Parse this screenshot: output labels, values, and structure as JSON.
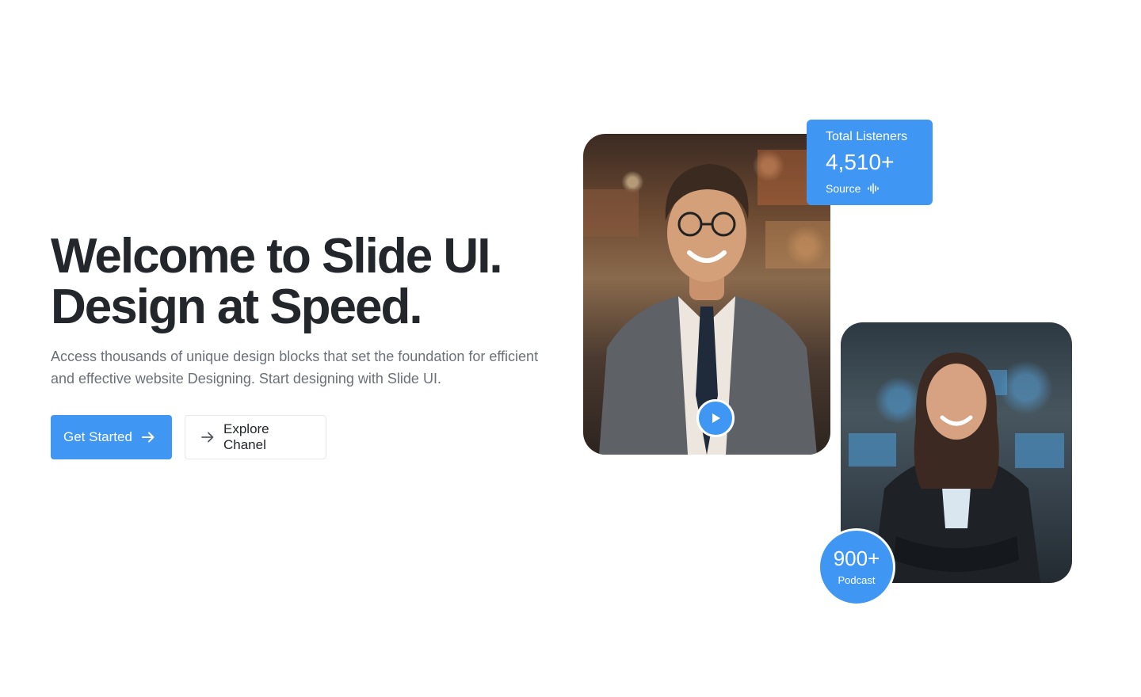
{
  "hero": {
    "title_line1": "Welcome to Slide UI.",
    "title_line2": "Design at Speed.",
    "description": "Access thousands of unique design blocks that set the foundation for efficient and effective website Designing. Start designing with Slide UI.",
    "primary_cta": "Get Started",
    "secondary_cta": "Explore Chanel"
  },
  "stats_card": {
    "label": "Total Listeners",
    "value": "4,510+",
    "source_label": "Source",
    "source_icon": "audio-waveform-icon"
  },
  "podcast_badge": {
    "value": "900+",
    "label": "Podcast"
  },
  "images": {
    "man": "smiling-man-in-suit-photo",
    "woman": "smiling-woman-in-office-photo"
  },
  "colors": {
    "accent": "#4096f3",
    "heading": "#23272b",
    "body_text": "#6b7177",
    "border": "#e6e8eb"
  }
}
